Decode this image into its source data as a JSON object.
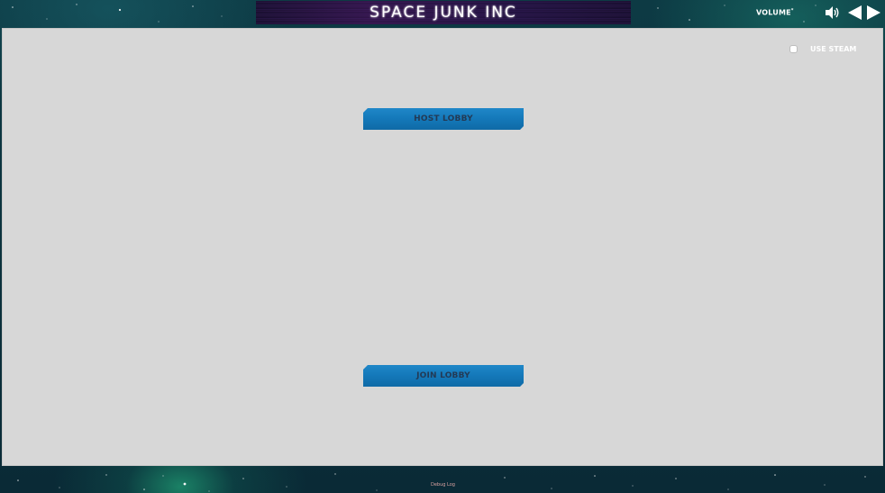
{
  "app": {
    "title": "SPACE JUNK INC"
  },
  "volume": {
    "label": "VOLUME",
    "superscript": "*"
  },
  "options": {
    "use_steam_label": "USE STEAM",
    "use_steam_checked": false
  },
  "buttons": {
    "host_lobby": "HOST LOBBY",
    "join_lobby": "JOIN LOBBY"
  },
  "footer": {
    "debug_log": "Debug Log"
  },
  "icons": {
    "speaker": "speaker-icon",
    "volume_down": "triangle-left-icon",
    "volume_up": "triangle-right-icon"
  },
  "colors": {
    "panel_bg": "#d7d7d7",
    "button_blue": "#1478b9",
    "button_text": "#233a55",
    "title_text": "#ffffff"
  }
}
